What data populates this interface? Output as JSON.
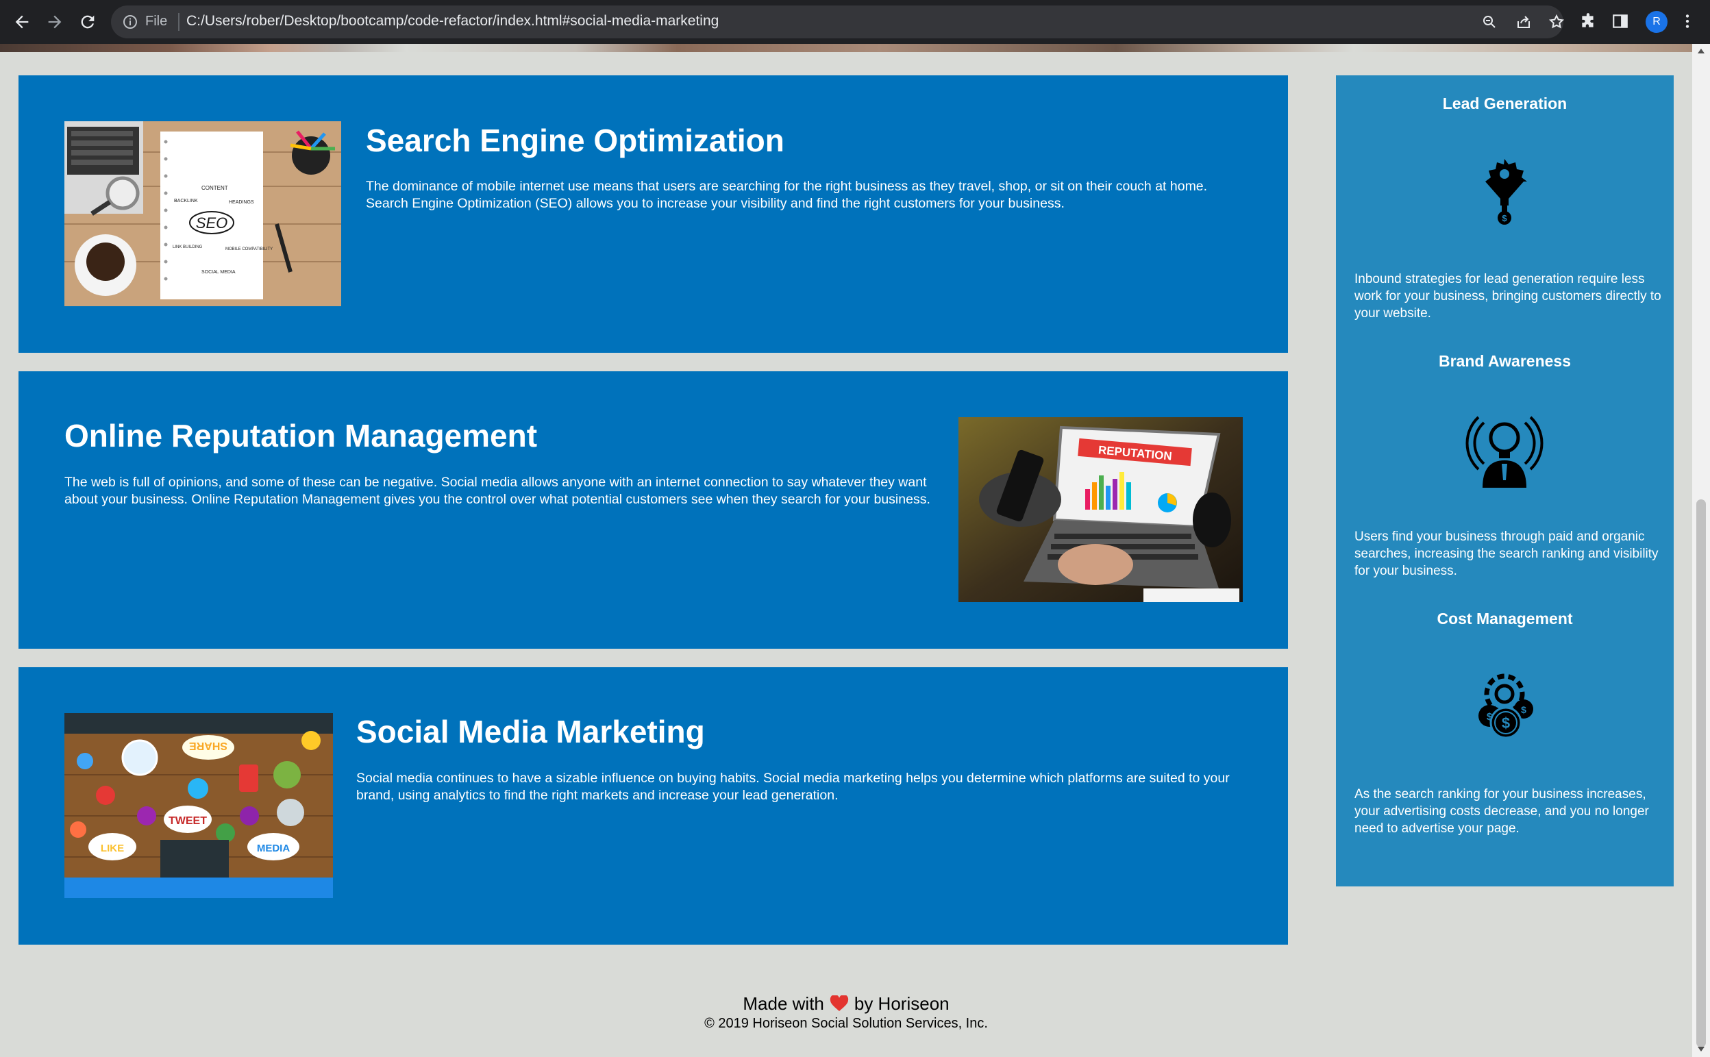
{
  "browser": {
    "file_label": "File",
    "url": "C:/Users/rober/Desktop/bootcamp/code-refactor/index.html#social-media-marketing",
    "avatar_initial": "R",
    "icons": [
      "back-arrow-icon",
      "forward-arrow-icon",
      "reload-icon",
      "info-icon",
      "zoom-icon",
      "share-icon",
      "star-icon",
      "extensions-icon",
      "side-panel-icon",
      "menu-icon"
    ]
  },
  "sections": [
    {
      "id": "search-engine-optimization",
      "title": "Search Engine Optimization",
      "text": "The dominance of mobile internet use means that users are searching for the right business as they travel, shop, or sit on their couch at home. Search Engine Optimization (SEO) allows you to increase your visibility and find the right customers for your business.",
      "image_labels": [
        "CONTENT",
        "BACKLINK",
        "HEADINGS",
        "SEO",
        "LINK BUILDING",
        "MOBILE COMPATIBILITY",
        "SOCIAL MEDIA"
      ]
    },
    {
      "id": "online-reputation-management",
      "title": "Online Reputation Management",
      "text": "The web is full of opinions, and some of these can be negative. Social media allows anyone with an internet connection to say whatever they want about your business. Online Reputation Management gives you the control over what potential customers see when they search for your business.",
      "image_labels": [
        "REPUTATION"
      ]
    },
    {
      "id": "social-media-marketing",
      "title": "Social Media Marketing",
      "text": "Social media continues to have a sizable influence on buying habits. Social media marketing helps you determine which platforms are suited to your brand, using analytics to find the right markets and increase your lead generation.",
      "image_labels": [
        "SHARE",
        "TWEET",
        "LIKE",
        "MEDIA"
      ]
    }
  ],
  "benefits": [
    {
      "title": "Lead Generation",
      "icon": "lead-generation-icon",
      "text": "Inbound strategies for lead generation require less work for your business, bringing customers directly to your website."
    },
    {
      "title": "Brand Awareness",
      "icon": "brand-awareness-icon",
      "text": "Users find your business through paid and organic searches, increasing the search ranking and visibility for your business."
    },
    {
      "title": "Cost Management",
      "icon": "cost-management-icon",
      "text": "As the search ranking for your business increases, your advertising costs decrease, and you no longer need to advertise your page."
    }
  ],
  "footer": {
    "made_with": "Made with",
    "by": "by Horiseon",
    "copyright": "© 2019 Horiseon Social Solution Services, Inc."
  },
  "colors": {
    "card_bg": "#0072bb",
    "sidebar_bg": "#2589bd",
    "page_bg": "#d9dbd7",
    "heart": "#e3342f"
  }
}
